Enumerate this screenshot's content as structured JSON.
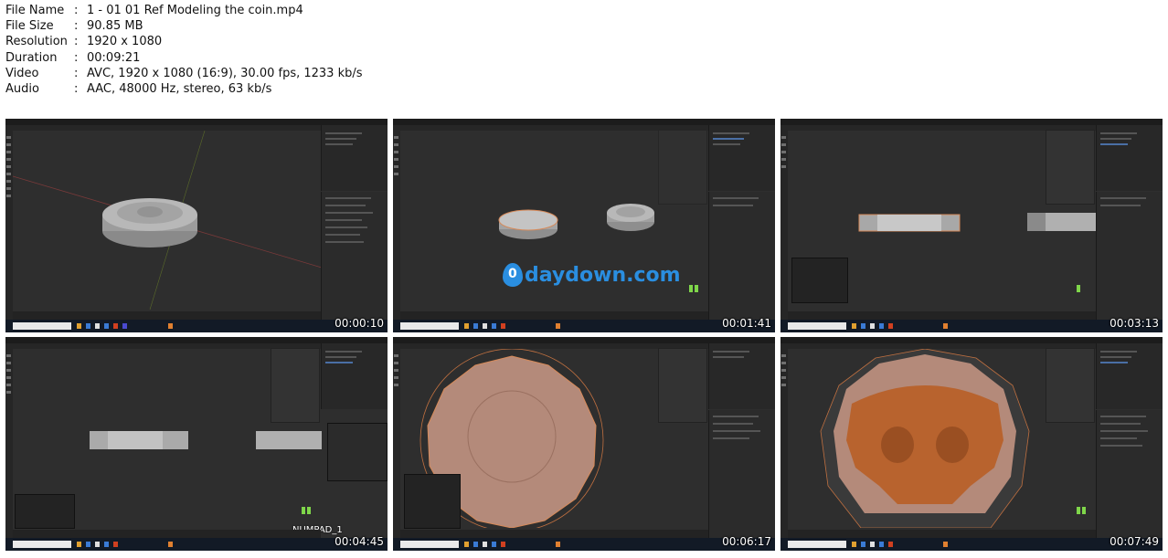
{
  "info": [
    {
      "key": "File Name",
      "value": "1 - 01 01 Ref Modeling the coin.mp4"
    },
    {
      "key": "File Size",
      "value": "90.85 MB"
    },
    {
      "key": "Resolution",
      "value": "1920 x 1080"
    },
    {
      "key": "Duration",
      "value": "00:09:21"
    },
    {
      "key": "Video",
      "value": "AVC, 1920 x 1080 (16:9), 30.00 fps, 1233 kb/s"
    },
    {
      "key": "Audio",
      "value": "AAC, 48000 Hz, stereo, 63 kb/s"
    }
  ],
  "separator": ":",
  "thumbs": [
    {
      "timestamp": "00:00:10",
      "search": "Type here to search"
    },
    {
      "timestamp": "00:01:41",
      "search": "Type here to search"
    },
    {
      "timestamp": "00:03:13",
      "search": "Type here to search"
    },
    {
      "timestamp": "00:04:45",
      "search": "Type here to search"
    },
    {
      "timestamp": "00:06:17",
      "search": "Type here to search"
    },
    {
      "timestamp": "00:07:49",
      "search": "Type here to search"
    }
  ],
  "watermark": "daydown.com",
  "numpad_label": "NUMPAD_1",
  "colors": {
    "accent": "#2a8ee0",
    "viewport": "#2e2e2e",
    "selection": "#d68a5a"
  }
}
